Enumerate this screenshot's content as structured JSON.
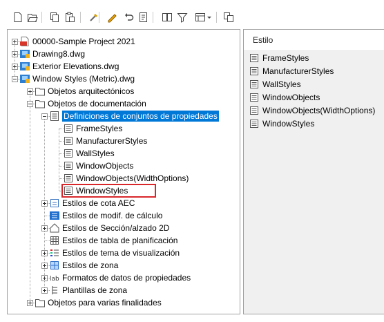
{
  "toolbar": {
    "buttons": [
      "new-icon",
      "open-icon",
      "copy-icon",
      "paste-icon",
      "purge-icon",
      "edit-icon",
      "undo-icon",
      "edit-style-icon",
      "properties-icon",
      "filter-icon",
      "view-icon",
      "dropdown-icon",
      "duplicate-icon"
    ]
  },
  "tree": {
    "items": [
      {
        "label": "00000-Sample Project 2021",
        "icon": "pdf-project-icon",
        "level": 0,
        "expander": "plus"
      },
      {
        "label": "Drawing8.dwg",
        "icon": "drawing-icon",
        "level": 0,
        "expander": "plus"
      },
      {
        "label": "Exterior Elevations.dwg",
        "icon": "drawing-icon",
        "level": 0,
        "expander": "plus"
      },
      {
        "label": "Window Styles (Metric).dwg",
        "icon": "drawing-icon",
        "level": 0,
        "expander": "minus"
      },
      {
        "label": "Objetos arquitectónicos",
        "icon": "folder-icon",
        "level": 1,
        "expander": "plus"
      },
      {
        "label": "Objetos de documentación",
        "icon": "folder-icon",
        "level": 1,
        "expander": "minus"
      },
      {
        "label": "Definiciones de conjuntos de propiedades",
        "icon": "list-icon",
        "level": 2,
        "expander": "minus",
        "selected": true
      },
      {
        "label": "FrameStyles",
        "icon": "style-doc-icon",
        "level": 3
      },
      {
        "label": "ManufacturerStyles",
        "icon": "style-doc-icon",
        "level": 3
      },
      {
        "label": "WallStyles",
        "icon": "style-doc-icon",
        "level": 3
      },
      {
        "label": "WindowObjects",
        "icon": "style-doc-icon",
        "level": 3
      },
      {
        "label": "WindowObjects(WidthOptions)",
        "icon": "style-doc-icon",
        "level": 3
      },
      {
        "label": "WindowStyles",
        "icon": "style-doc-icon",
        "level": 3,
        "highlighted": true
      },
      {
        "label": "Estilos de cota AEC",
        "icon": "dimension-icon",
        "level": 2,
        "expander": "plus"
      },
      {
        "label": "Estilos de modif. de cálculo",
        "icon": "calc-icon",
        "level": 2
      },
      {
        "label": "Estilos de Sección/alzado 2D",
        "icon": "section-icon",
        "level": 2,
        "expander": "plus"
      },
      {
        "label": "Estilos de tabla de planificación",
        "icon": "table-icon",
        "level": 2
      },
      {
        "label": "Estilos de tema de visualización",
        "icon": "theme-icon",
        "level": 2,
        "expander": "plus"
      },
      {
        "label": "Estilos de zona",
        "icon": "zone-icon",
        "level": 2,
        "expander": "plus"
      },
      {
        "label": "Formatos de datos de propiedades",
        "icon": "data-format-icon",
        "level": 2,
        "expander": "plus"
      },
      {
        "label": "Plantillas de zona",
        "icon": "zone-template-icon",
        "level": 2,
        "expander": "plus"
      },
      {
        "label": "Objetos para varias finalidades",
        "icon": "folder-icon",
        "level": 1,
        "expander": "plus"
      }
    ]
  },
  "list": {
    "header": "Estilo",
    "items": [
      "FrameStyles",
      "ManufacturerStyles",
      "WallStyles",
      "WindowObjects",
      "WindowObjects(WidthOptions)",
      "WindowStyles"
    ]
  }
}
